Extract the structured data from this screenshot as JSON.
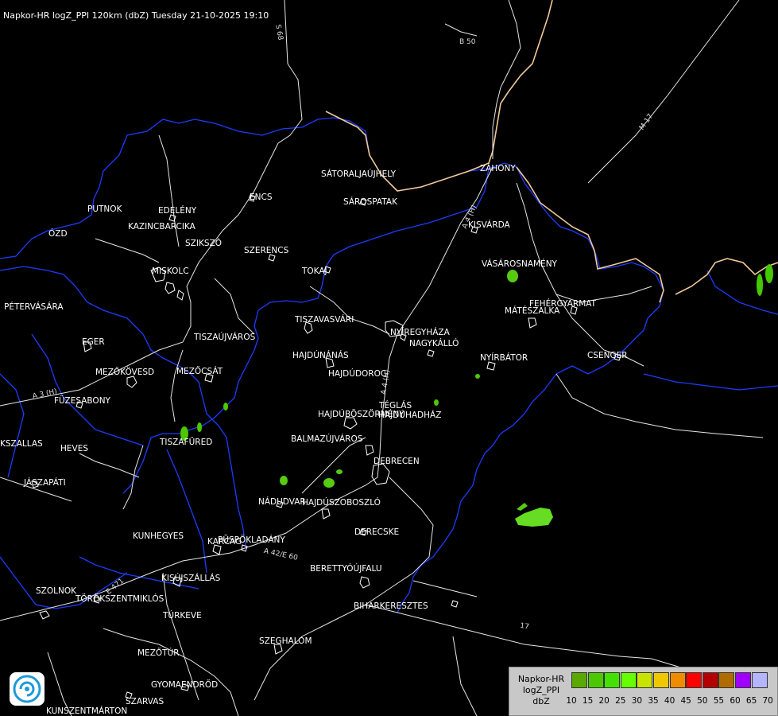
{
  "title": "Napkor-HR logZ_PPI 120km (dbZ) Tuesday 21-10-2025 19:10",
  "cities": [
    {
      "name": "SÁTORALJAÚJHELY"
    },
    {
      "name": "SÁROSPATAK"
    },
    {
      "name": "ZÁHONY"
    },
    {
      "name": "PUTNOK"
    },
    {
      "name": "EDELÉNY"
    },
    {
      "name": "ENCS"
    },
    {
      "name": "KAZINCBARCIKA"
    },
    {
      "name": "ÓZD"
    },
    {
      "name": "SZIKSZÓ"
    },
    {
      "name": "SZERENCS"
    },
    {
      "name": "KISVÁRDA"
    },
    {
      "name": "MISKOLC"
    },
    {
      "name": "TOKAJ"
    },
    {
      "name": "VÁSÁROSNAMÉNY"
    },
    {
      "name": "PÉTERVÁSÁRA"
    },
    {
      "name": "FEHÉRGYARMAT"
    },
    {
      "name": "MÁTÉSZALKA"
    },
    {
      "name": "TISZAVASVÁRI"
    },
    {
      "name": "NYÍREGYHÁZA"
    },
    {
      "name": "EGER"
    },
    {
      "name": "TISZAÚJVÁROS"
    },
    {
      "name": "NAGYKÁLLÓ"
    },
    {
      "name": "HAJDÚNÁNÁS"
    },
    {
      "name": "NYÍRBÁTOR"
    },
    {
      "name": "CSENGER"
    },
    {
      "name": "MEZŐKÖVESD"
    },
    {
      "name": "MEZŐCSÁT"
    },
    {
      "name": "HAJDÚDOROG"
    },
    {
      "name": "FÜZESABONY"
    },
    {
      "name": "TÉGLÁS"
    },
    {
      "name": "HAJDÚBÖSZÖRMÉNY"
    },
    {
      "name": "HAJDÚHADHÁZ"
    },
    {
      "name": "TISZAFÜRED"
    },
    {
      "name": "BALMAZÚJVÁROS"
    },
    {
      "name": "KSZALLAS"
    },
    {
      "name": "HEVES"
    },
    {
      "name": "DEBRECEN"
    },
    {
      "name": "JÁSZAPÁTI"
    },
    {
      "name": "NÁDUDVAR"
    },
    {
      "name": "HAJDÚSZOBOSZLÓ"
    },
    {
      "name": "DERECSKE"
    },
    {
      "name": "KUNHEGYES"
    },
    {
      "name": "KARCAG"
    },
    {
      "name": "PÜSPÖKLADÁNY"
    },
    {
      "name": "BERETTYÓÚJFALU"
    },
    {
      "name": "KISÚJSZÁLLÁS"
    },
    {
      "name": "SZOLNOK"
    },
    {
      "name": "TÖRÖKSZENTMIKLÓS"
    },
    {
      "name": "BIHARKERESZTES"
    },
    {
      "name": "TÚRKEVE"
    },
    {
      "name": "SZEGHALOM"
    },
    {
      "name": "MEZŐTÚR"
    },
    {
      "name": "GYOMAENDRŐD"
    },
    {
      "name": "SZARVAS"
    },
    {
      "name": "KUNSZENTMÁRTON"
    }
  ],
  "roads": [
    "B 50",
    "S 68",
    "M-17",
    "A 4 (H)",
    "A 3 (H)",
    "A 42/E 60",
    "E 471",
    "17",
    "A 4 (H)",
    "17"
  ],
  "legend": {
    "line1": "Napkor-HR",
    "line2": "logZ_PPI",
    "line3": "dbZ",
    "ticks": [
      "10",
      "15",
      "20",
      "25",
      "30",
      "35",
      "40",
      "45",
      "50",
      "55",
      "60",
      "65",
      "70"
    ],
    "colors": [
      "#5aa800",
      "#4cc800",
      "#44e000",
      "#66ff00",
      "#c8e400",
      "#f0c800",
      "#f08c00",
      "#ff0000",
      "#b40000",
      "#b06c00",
      "#a000ff",
      "#b4b4ff"
    ]
  },
  "logo_icon": "weather-service-logo-icon"
}
